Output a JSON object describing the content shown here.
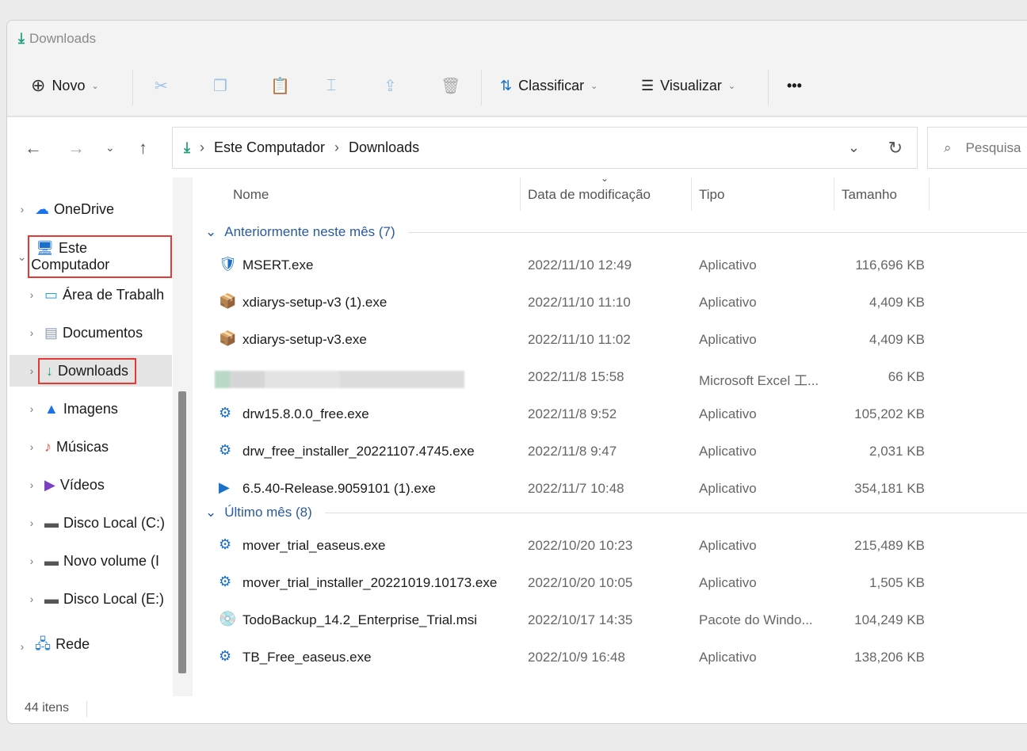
{
  "window": {
    "title": "Downloads"
  },
  "toolbar": {
    "new": "Novo",
    "sort": "Classificar",
    "view": "Visualizar",
    "more": "•••"
  },
  "address": {
    "parts": [
      "Este Computador",
      "Downloads"
    ],
    "search_placeholder": "Pesquisa"
  },
  "sidebar": {
    "items": [
      {
        "label": "OneDrive",
        "icon": "☁"
      },
      {
        "label": "Este Computador",
        "icon": "🖥"
      },
      {
        "label": "Área de Trabalh",
        "icon": "▭"
      },
      {
        "label": "Documentos",
        "icon": "▤"
      },
      {
        "label": "Downloads",
        "icon": "↓"
      },
      {
        "label": "Imagens",
        "icon": "▲"
      },
      {
        "label": "Músicas",
        "icon": "♪"
      },
      {
        "label": "Vídeos",
        "icon": "▶"
      },
      {
        "label": "Disco Local (C:)",
        "icon": "▬"
      },
      {
        "label": "Novo volume (I",
        "icon": "▬"
      },
      {
        "label": "Disco Local (E:)",
        "icon": "▬"
      },
      {
        "label": "Rede",
        "icon": "🖧"
      }
    ]
  },
  "columns": [
    "Nome",
    "Data de modificação",
    "Tipo",
    "Tamanho"
  ],
  "groups": [
    {
      "label": "Anteriormente neste mês (7)",
      "files": [
        {
          "name": "MSERT.exe",
          "date": "2022/11/10 12:49",
          "type": "Aplicativo",
          "size": "116,696 KB"
        },
        {
          "name": "xdiarys-setup-v3 (1).exe",
          "date": "2022/11/10 11:10",
          "type": "Aplicativo",
          "size": "4,409 KB"
        },
        {
          "name": "xdiarys-setup-v3.exe",
          "date": "2022/11/10 11:02",
          "type": "Aplicativo",
          "size": "4,409 KB"
        },
        {
          "name": "",
          "date": "2022/11/8 15:58",
          "type": "Microsoft Excel 工...",
          "size": "66 KB",
          "blurred": true
        },
        {
          "name": "drw15.8.0.0_free.exe",
          "date": "2022/11/8 9:52",
          "type": "Aplicativo",
          "size": "105,202 KB"
        },
        {
          "name": "drw_free_installer_20221107.4745.exe",
          "date": "2022/11/8 9:47",
          "type": "Aplicativo",
          "size": "2,031 KB"
        },
        {
          "name": "6.5.40-Release.9059101 (1).exe",
          "date": "2022/11/7 10:48",
          "type": "Aplicativo",
          "size": "354,181 KB"
        }
      ]
    },
    {
      "label": "Último mês (8)",
      "files": [
        {
          "name": "mover_trial_easeus.exe",
          "date": "2022/10/20 10:23",
          "type": "Aplicativo",
          "size": "215,489 KB"
        },
        {
          "name": "mover_trial_installer_20221019.10173.exe",
          "date": "2022/10/20 10:05",
          "type": "Aplicativo",
          "size": "1,505 KB"
        },
        {
          "name": "TodoBackup_14.2_Enterprise_Trial.msi",
          "date": "2022/10/17 14:35",
          "type": "Pacote do Windo...",
          "size": "104,249 KB"
        },
        {
          "name": "TB_Free_easeus.exe",
          "date": "2022/10/9 16:48",
          "type": "Aplicativo",
          "size": "138,206 KB"
        }
      ]
    }
  ],
  "status": {
    "count": "44 itens"
  },
  "colors": {
    "accent": "#1a9f7a",
    "group": "#2a5a9e",
    "highlight": "#e53935"
  }
}
